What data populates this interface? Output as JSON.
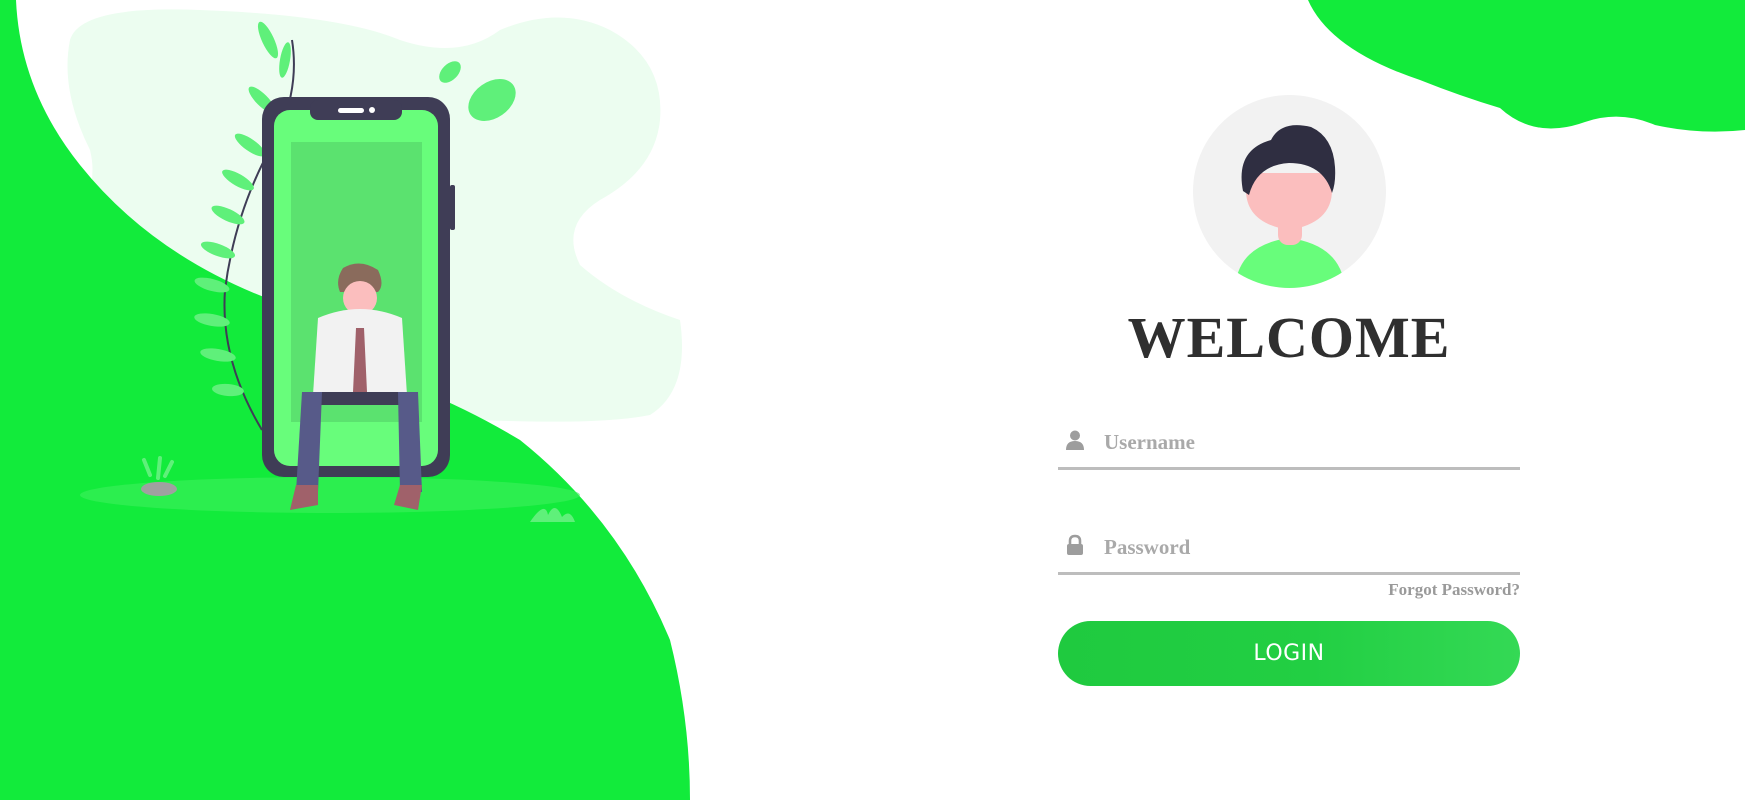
{
  "colors": {
    "brand_green": "#12eb3b",
    "light_green": "#ecfdf0",
    "text_dark": "#2f2f2f",
    "placeholder": "#a9a9a9",
    "underline": "#bdbdbd"
  },
  "illustration": {
    "icon": "person-sitting-on-phone-illustration"
  },
  "login": {
    "avatar_icon": "user-avatar-icon",
    "title": "WELCOME",
    "username": {
      "icon": "user-icon",
      "placeholder": "Username",
      "value": ""
    },
    "password": {
      "icon": "lock-icon",
      "placeholder": "Password",
      "value": ""
    },
    "forgot_label": "Forgot Password?",
    "button_label": "LOGIN"
  }
}
